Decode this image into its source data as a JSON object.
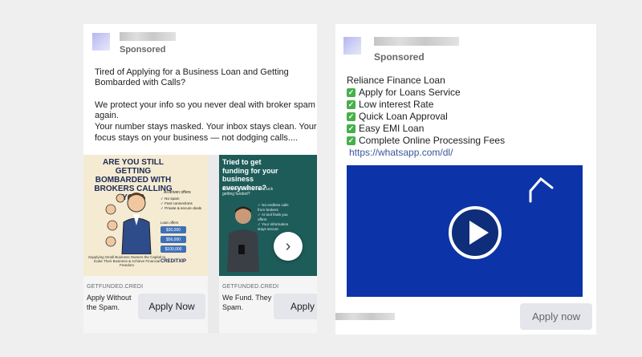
{
  "left_ad": {
    "sponsored": "Sponsored",
    "body_line1": "Tired of Applying for a Business Loan and Getting",
    "body_line2": "Bombarded with Calls?",
    "body_line3": "We protect your info so you never deal with broker spam",
    "body_line4": "again.",
    "body_line5": "Your number stays masked. Your inbox stays clean. Your",
    "body_line6": "focus stays on your business — not dodging calls....",
    "carousel": [
      {
        "image_heading": "ARE YOU STILL GETTING BOMBARDED WITH BROKERS CALLING YOU?",
        "image_sub": "AI-driven offers",
        "image_list": [
          "✓ No spam",
          "✓ Fast connections",
          "✓ Private & secure deals"
        ],
        "loan_offers_label": "Loan offers",
        "prices": [
          "$30,000",
          "$56,000",
          "$100,000"
        ],
        "image_footer": "Supplying Small Business Owners the Capital to Scale Their Business & Achieve Financial Freedom",
        "brand": "CREDITXIP",
        "domain": "GETFUNDED.CREDI",
        "title_line1": "Apply Without",
        "title_line2": "the Spam.",
        "cta": "Apply Now"
      },
      {
        "image_heading": "Tried to get funding for your business everywhere?",
        "image_sub": "But never seem to have luck getting funded?",
        "image_list": [
          "✓ No endless calls from brokers",
          "✓ AI tool finds you offers",
          "✓ Your information stays secure"
        ],
        "domain": "GETFUNDED.CREDI",
        "title_line1": "We Fund. They",
        "title_line2": "Spam.",
        "cta": "Apply N"
      }
    ],
    "next_icon": "chevron-right-icon"
  },
  "right_ad": {
    "sponsored": "Sponsored",
    "title": "Reliance Finance Loan",
    "features": [
      "Apply for Loans Service",
      "Low interest Rate",
      "Quick Loan Approval",
      "Easy EMI Loan",
      "Complete Online Processing Fees"
    ],
    "check_glyph": "✓",
    "link": "https://whatsapp.com/dl/",
    "cta": "Apply now",
    "video_color": "#0c34a8"
  }
}
